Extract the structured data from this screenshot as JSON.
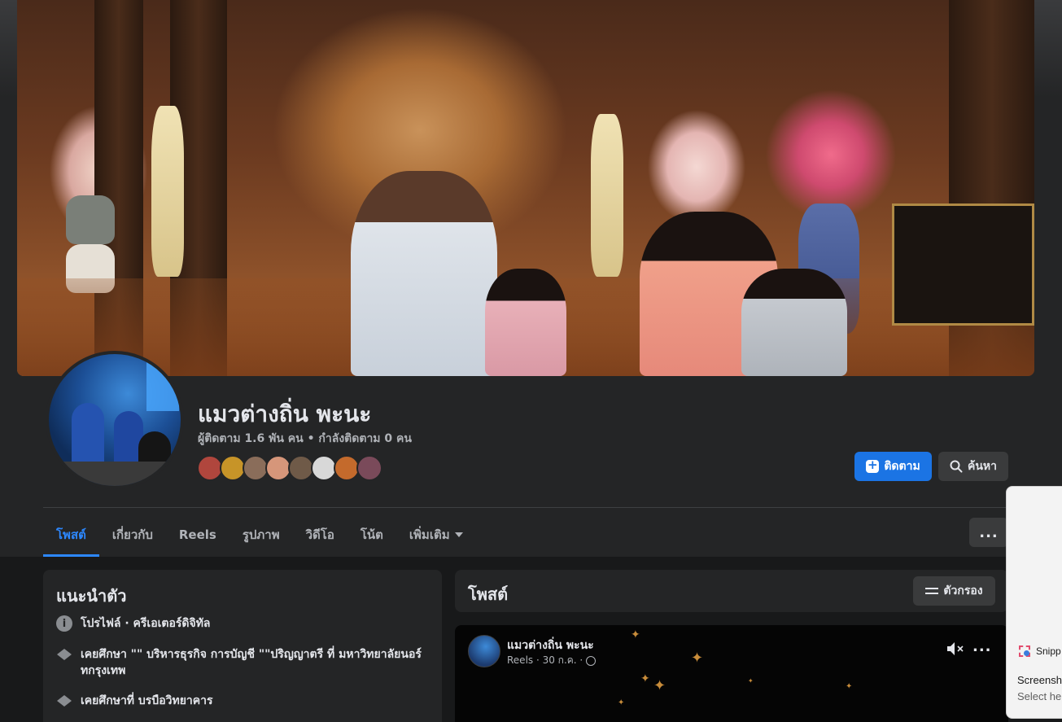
{
  "profile": {
    "name": "แมวต่างถิ่น พะนะ",
    "follow_stats": "ผู้ติดตาม 1.6 พัน คน • กำลังติดตาม 0 คน",
    "follow_button": "ติดตาม",
    "search_button": "ค้นหา",
    "follower_avatar_colors": [
      "#b0463d",
      "#c79428",
      "#8a6d5a",
      "#d6967a",
      "#6f5a48",
      "#d8d8d8",
      "#c46a2c",
      "#7a4a5a"
    ]
  },
  "tabs": [
    {
      "label": "โพสต์",
      "active": true
    },
    {
      "label": "เกี่ยวกับ",
      "active": false
    },
    {
      "label": "Reels",
      "active": false
    },
    {
      "label": "รูปภาพ",
      "active": false
    },
    {
      "label": "วิดีโอ",
      "active": false
    },
    {
      "label": "โน้ต",
      "active": false
    },
    {
      "label": "เพิ่มเติม",
      "active": false
    }
  ],
  "more_menu": "...",
  "intro": {
    "title": "แนะนำตัว",
    "items": [
      {
        "icon": "info-icon",
        "text": "โปรไฟล์ · ครีเอเตอร์ดิจิทัล"
      },
      {
        "icon": "graduation-cap-icon",
        "text": "เคยศึกษา \"\" บริหารธุรกิจ การบัญชี \"\"ปริญญาตรี ที่ มหาวิทยาลัยนอร์ทกรุงเทพ"
      },
      {
        "icon": "graduation-cap-icon",
        "text": "เคยศึกษาที่ บรบือวิทยาคาร"
      }
    ]
  },
  "posts": {
    "title": "โพสต์",
    "filter_button": "ตัวกรอง",
    "first_post": {
      "author": "แมวต่างถิ่น พะนะ",
      "meta": "Reels · 30 ก.ค. ·"
    }
  },
  "toast": {
    "app": "Snipp",
    "title": "Screensh",
    "subtitle": "Select he"
  },
  "colors": {
    "accent": "#2d88ff",
    "follow_button": "#1b74e4",
    "surface": "#242526",
    "background": "#18191a"
  }
}
